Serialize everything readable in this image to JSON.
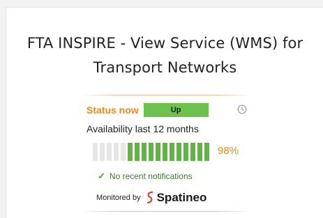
{
  "widget": {
    "title_line1": "FTA INSPIRE - View Service (WMS) for",
    "title_line2": "Transport Networks",
    "status_label": "Status now",
    "status_value": "Up",
    "availability_label": "Availability last 12 months",
    "availability_percent": "98%",
    "availability_value": 98,
    "notifications_text": "No recent notifications",
    "monitored_by": "Monitored by",
    "brand_name": "Spatineo"
  },
  "availability_bars": [
    {
      "state": "none"
    },
    {
      "state": "none"
    },
    {
      "state": "none"
    },
    {
      "state": "none"
    },
    {
      "state": "none"
    },
    {
      "state": "up"
    },
    {
      "state": "up"
    },
    {
      "state": "up"
    },
    {
      "state": "up"
    },
    {
      "state": "up"
    },
    {
      "state": "up"
    },
    {
      "state": "up"
    },
    {
      "state": "up"
    },
    {
      "state": "up"
    },
    {
      "state": "up"
    },
    {
      "state": "up"
    },
    {
      "state": "up"
    }
  ],
  "colors": {
    "accent_orange": "#f08a18",
    "status_up": "#6cc24a",
    "bar_up": "#5cb83a",
    "bar_none": "#e6e6e6",
    "brand_red": "#e23a2c"
  },
  "icons": {
    "status_clock": "clock-icon",
    "notification": "check-icon",
    "brand_logo": "spatineo-logo-icon"
  }
}
